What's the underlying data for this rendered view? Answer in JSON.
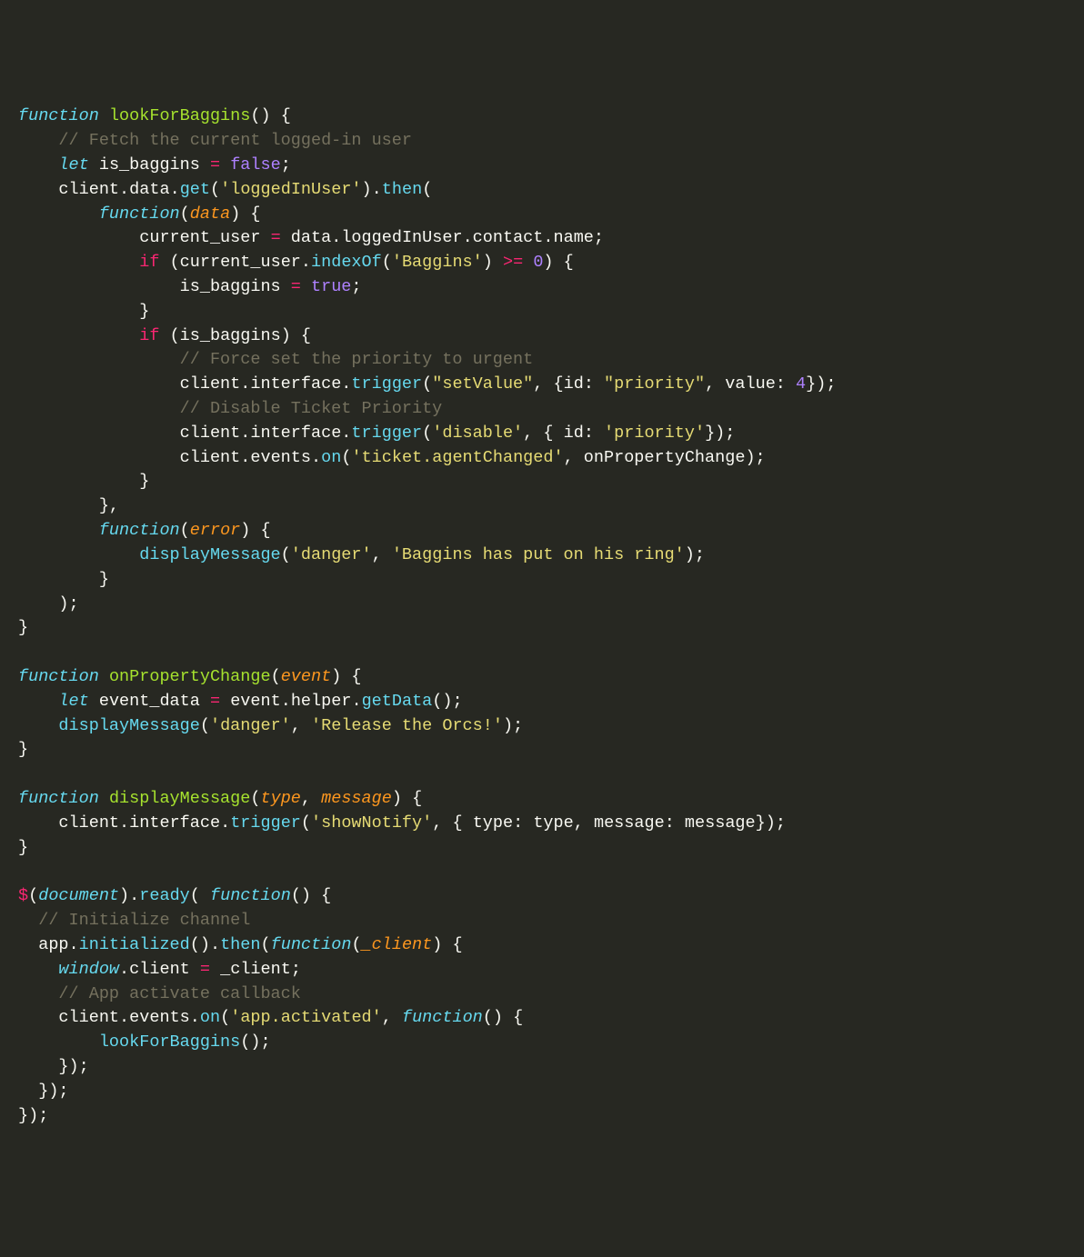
{
  "code": {
    "fn1_name": "lookForBaggins",
    "comment_fetch": "// Fetch the current logged-in user",
    "let1": "let",
    "is_baggins": "is_baggins",
    "false_kw": "false",
    "client": "client",
    "data_prop": "data",
    "get_fn": "get",
    "str_loggedInUser": "'loggedInUser'",
    "then_fn": "then",
    "function_kw": "function",
    "data_param": "data",
    "current_user": "current_user",
    "loggedInUser_prop": "loggedInUser",
    "contact_prop": "contact",
    "name_prop": "name",
    "if_kw": "if",
    "indexOf_fn": "indexOf",
    "str_Baggins": "'Baggins'",
    "gte": ">=",
    "zero": "0",
    "true_kw": "true",
    "comment_force": "// Force set the priority to urgent",
    "interface_prop": "interface",
    "trigger_fn": "trigger",
    "str_setValue": "\"setValue\"",
    "id_key": "id",
    "str_priority_dq": "\"priority\"",
    "value_key": "value",
    "four": "4",
    "comment_disable": "// Disable Ticket Priority",
    "str_disable": "'disable'",
    "str_priority_sq": "'priority'",
    "events_prop": "events",
    "on_fn": "on",
    "str_agentChanged": "'ticket.agentChanged'",
    "onPropertyChange_ref": "onPropertyChange",
    "error_param": "error",
    "displayMessage_fn": "displayMessage",
    "str_danger": "'danger'",
    "str_ring": "'Baggins has put on his ring'",
    "fn2_name": "onPropertyChange",
    "event_param": "event",
    "event_data": "event_data",
    "helper_prop": "helper",
    "getData_fn": "getData",
    "str_orcs": "'Release the Orcs!'",
    "fn3_name": "displayMessage",
    "type_param": "type",
    "message_param": "message",
    "str_showNotify": "'showNotify'",
    "type_key": "type",
    "message_key": "message",
    "jquery": "$",
    "document_kw": "document",
    "ready_fn": "ready",
    "comment_init": "// Initialize channel",
    "app_var": "app",
    "initialized_fn": "initialized",
    "client_param": "_client",
    "window_kw": "window",
    "client_prop": "client",
    "client_var": "_client",
    "comment_callback": "// App activate callback",
    "str_activated": "'app.activated'",
    "lookForBaggins_call": "lookForBaggins"
  }
}
